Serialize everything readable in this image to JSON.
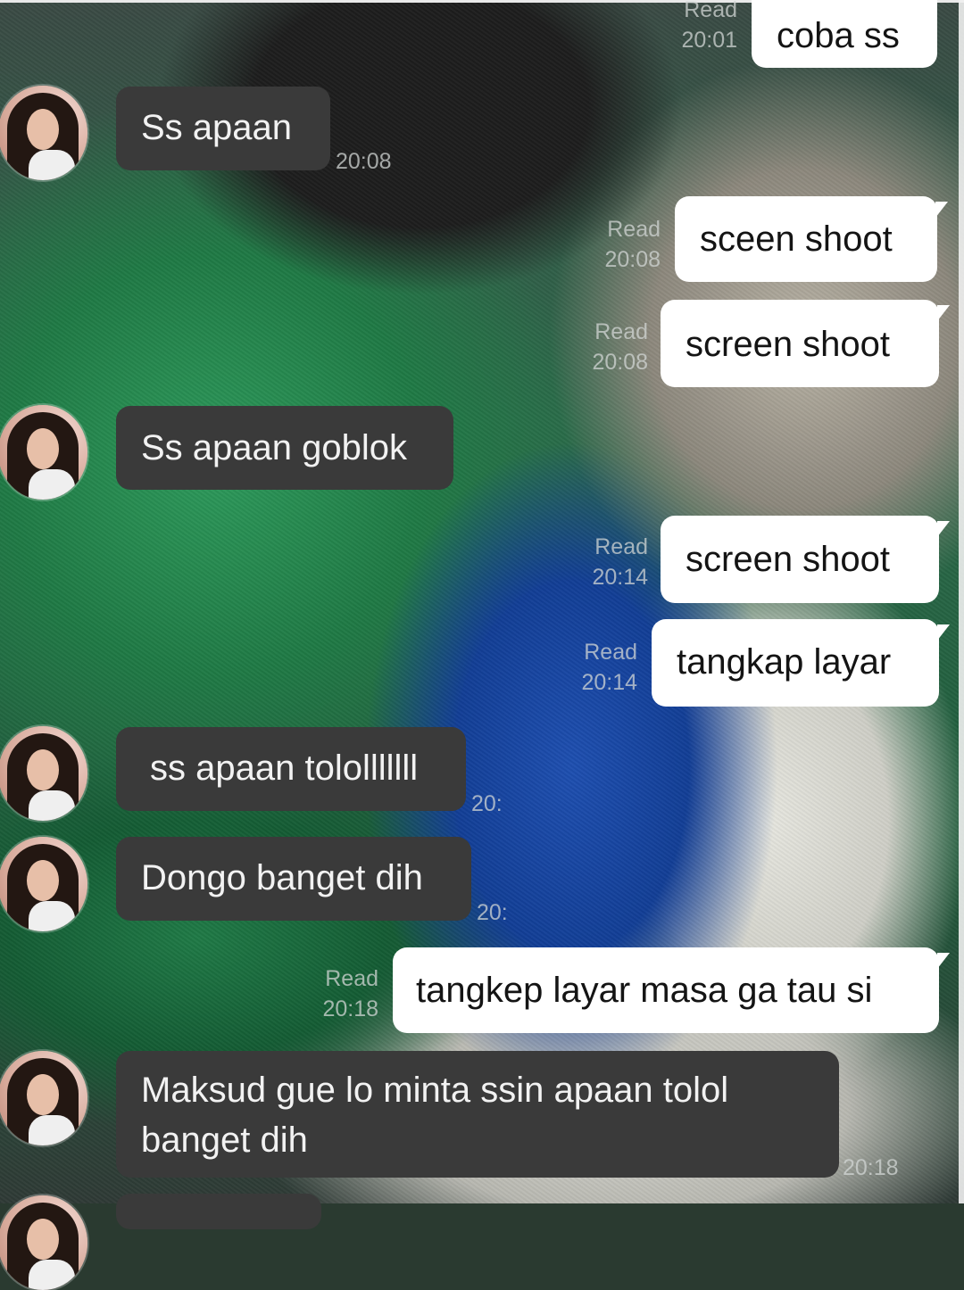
{
  "chat": {
    "messages": [
      {
        "dir": "out",
        "text": "coba ss",
        "status": "Read",
        "time": "20:01"
      },
      {
        "dir": "in",
        "text": "Ss apaan",
        "time": "20:08"
      },
      {
        "dir": "out",
        "text": "sceen shoot",
        "status": "Read",
        "time": "20:08"
      },
      {
        "dir": "out",
        "text": "screen shoot",
        "status": "Read",
        "time": "20:08"
      },
      {
        "dir": "in",
        "text": "Ss apaan goblok",
        "time": ""
      },
      {
        "dir": "out",
        "text": "screen shoot",
        "status": "Read",
        "time": "20:14"
      },
      {
        "dir": "out",
        "text": "tangkap layar",
        "status": "Read",
        "time": "20:14"
      },
      {
        "dir": "in",
        "text": "ss apaan tololllllll",
        "time": "20:"
      },
      {
        "dir": "in",
        "text": "Dongo banget dih",
        "time": "20:"
      },
      {
        "dir": "out",
        "text": "tangkep layar masa ga tau si",
        "status": "Read",
        "time": "20:18"
      },
      {
        "dir": "in",
        "text": "Maksud gue lo minta ssin apaan tolol banget dih",
        "time": "20:18"
      }
    ]
  },
  "colors": {
    "outgoing_bubble": "#ffffff",
    "incoming_bubble": "#3a3a3a",
    "meta_text": "#d2d6d4"
  }
}
